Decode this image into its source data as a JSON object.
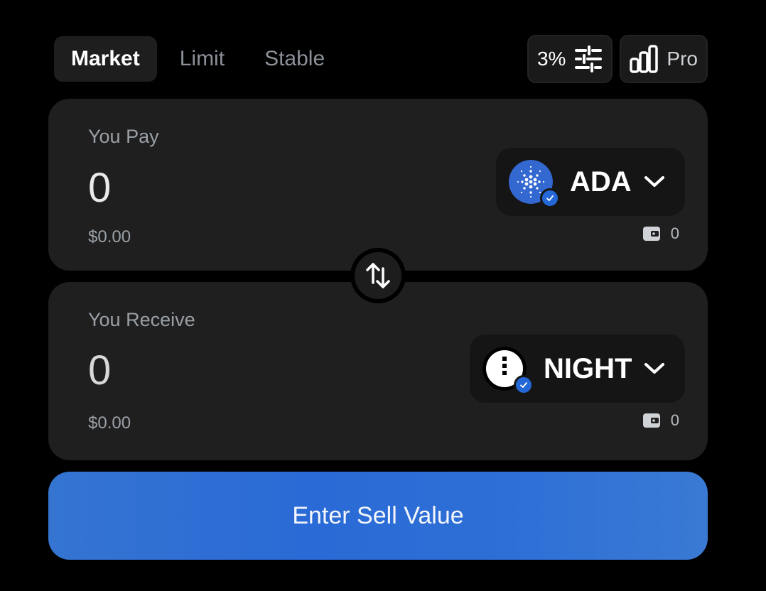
{
  "tabs": [
    {
      "label": "Market",
      "active": true
    },
    {
      "label": "Limit",
      "active": false
    },
    {
      "label": "Stable",
      "active": false
    }
  ],
  "slippage": {
    "label": "3%",
    "icon": "sliders-icon"
  },
  "pro": {
    "label": "Pro",
    "icon": "bar-chart-icon"
  },
  "pay": {
    "label": "You Pay",
    "amount": "0",
    "usd": "$0.00",
    "token": {
      "symbol": "ADA",
      "icon": "cardano-logo",
      "verified": true
    },
    "balance": "0",
    "balance_icon": "wallet-icon"
  },
  "receive": {
    "label": "You Receive",
    "amount": "0",
    "usd": "$0.00",
    "token": {
      "symbol": "NIGHT",
      "icon": "night-logo",
      "verified": true
    },
    "balance": "0",
    "balance_icon": "wallet-icon"
  },
  "swap_icon": "swap-arrows-icon",
  "action": {
    "label": "Enter Sell Value"
  },
  "colors": {
    "background": "#000000",
    "card": "#1f1f1f",
    "accent": "#2a6ad6",
    "verified": "#2467d6",
    "ada": "#3468d1"
  }
}
